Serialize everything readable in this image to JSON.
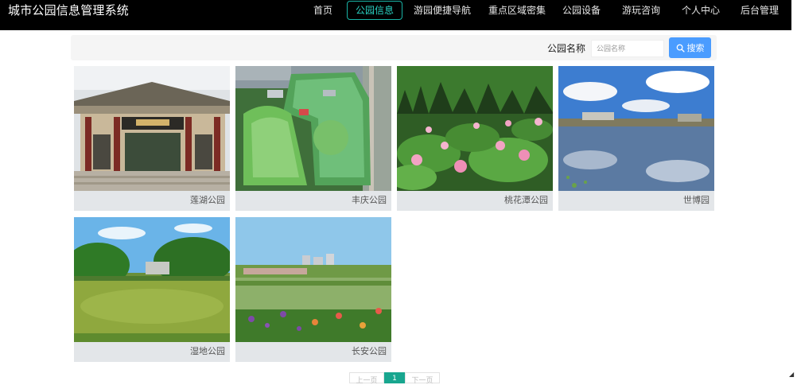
{
  "app": {
    "title": "城市公园信息管理系统"
  },
  "nav": {
    "items": [
      {
        "label": "首页"
      },
      {
        "label": "公园信息"
      },
      {
        "label": "游园便捷导航"
      },
      {
        "label": "重点区域密集"
      },
      {
        "label": "公园设备"
      },
      {
        "label": "游玩咨询"
      },
      {
        "label": "个人中心"
      },
      {
        "label": "后台管理"
      }
    ],
    "active": "公园信息"
  },
  "search": {
    "label": "公园名称",
    "placeholder": "公园名称",
    "button_label": "搜索"
  },
  "parks": [
    {
      "name": "莲湖公园"
    },
    {
      "name": "丰庆公园"
    },
    {
      "name": "桃花潭公园"
    },
    {
      "name": "世博园"
    },
    {
      "name": "湿地公园"
    },
    {
      "name": "长安公园"
    }
  ],
  "pagination": {
    "prev": "上一页",
    "current": "1",
    "next": "下一页"
  },
  "colors": {
    "nav_bg": "#000000",
    "nav_active": "#19b3a6",
    "search_button": "#4a9cff",
    "pager_active": "#18a68f",
    "caption_bg": "#e3e6e9"
  }
}
